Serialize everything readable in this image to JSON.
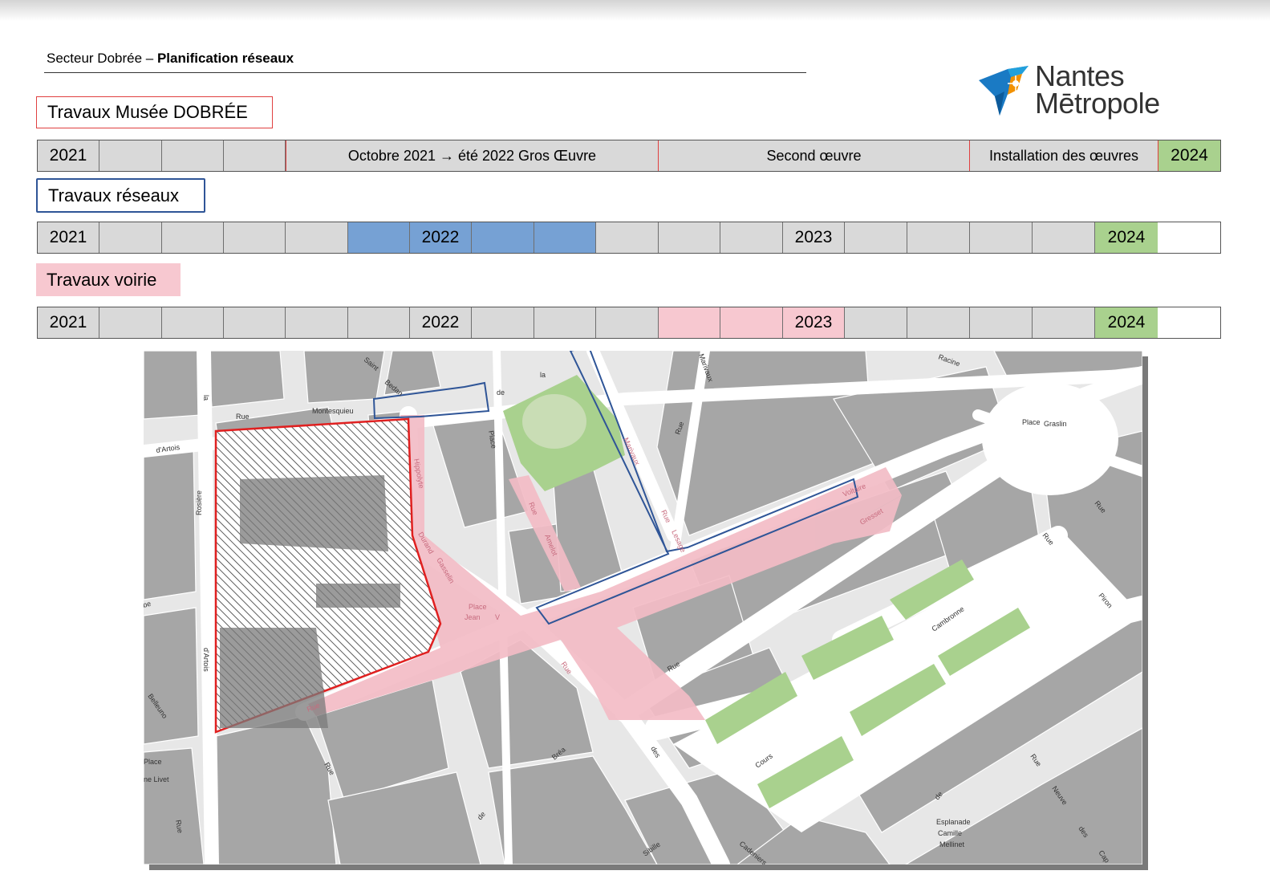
{
  "header": {
    "sector": "Secteur Dobrée – ",
    "title": "Planification réseaux"
  },
  "logo": {
    "line1": "Nantes",
    "line2": "Mētropole"
  },
  "musee": {
    "label": "Travaux Musée DOBRÉE",
    "start_year": "2021",
    "phases": [
      "Octobre 2021 → été 2022  Gros Œuvre",
      "Second œuvre",
      "Installation des œuvres"
    ],
    "end_year": "2024"
  },
  "reseaux": {
    "label": "Travaux réseaux",
    "years": [
      "2021",
      "2022",
      "2023",
      "2024"
    ]
  },
  "voirie": {
    "label": "Travaux voirie",
    "years": [
      "2021",
      "2022",
      "2023",
      "2024"
    ]
  },
  "colors": {
    "musee_border": "#e04040",
    "reseaux_border": "#2f5597",
    "reseaux_fill": "#76a1d4",
    "voirie_fill": "#f7c8d0",
    "year_end_fill": "#a9d18e",
    "cell_fill": "#d9d9d9"
  },
  "map": {
    "streets": {
      "rue_la": "la",
      "rue": "Rue",
      "montesquieu": "Montesquieu",
      "saint": "Saint",
      "bedan": "Bedan",
      "de": "de",
      "la2": "la",
      "marivaux": "Marivaux",
      "racine": "Racine",
      "place": "Place",
      "graslin": "Graslin",
      "darlois": "d'Artois",
      "rosiere": "Rosière",
      "hippolyte": "Hippolyte",
      "durand": "Durand",
      "gasselin": "Gasselin",
      "place_jean_v": "Place",
      "jean": "Jean",
      "v": "V",
      "rue_voltaire": "Voltaire",
      "gresset": "Gresset",
      "lessage": "Lesage",
      "rue_lesage": "Rue",
      "rue_amelot": "Rue",
      "amelot": "Amelot",
      "rue_e": "Rue",
      "cambronne": "Cambronne",
      "cours": "Cours",
      "rue_sl": "Rue",
      "breta": "Bréa",
      "des": "des",
      "de2": "de",
      "sibille": "Sibille",
      "cadeniers": "Cadeniers",
      "esplanade": "Esplanade",
      "camille": "Camille",
      "mellinet": "Mellinet",
      "rue_neuve": "Rue",
      "neuve": "Neuve",
      "des2": "des",
      "cap": "Cap",
      "de3": "de",
      "rue_r": "Rue",
      "rue_rr": "Rue",
      "piron": "Piron",
      "rue_g": "Rue",
      "rue_rosiere": "Rue",
      "place_livet": "Place",
      "livet": "ne   Livet",
      "bellamy": "Belleuno",
      "rue_left": "Rue",
      "rue_bottom": "Rue",
      "abe": "be",
      "dartois_top": "d'Artois",
      "rue_amelot2": "Rue"
    }
  }
}
